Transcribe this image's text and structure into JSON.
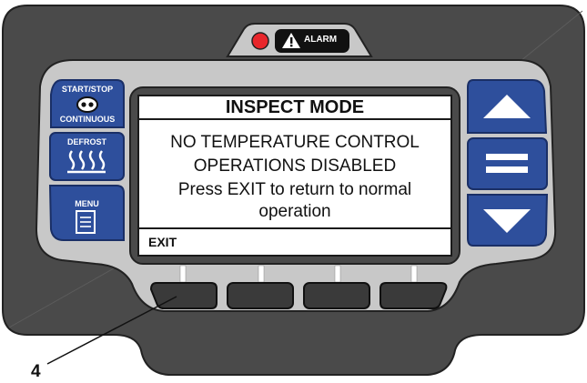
{
  "alarm": {
    "label": "ALARM"
  },
  "left_buttons": {
    "start_stop": {
      "label_top": "START/STOP",
      "label_bottom": "CONTINUOUS"
    },
    "defrost": {
      "label": "DEFROST"
    },
    "menu": {
      "label": "MENU"
    }
  },
  "screen": {
    "title": "INSPECT MODE",
    "lines": [
      "NO TEMPERATURE CONTROL",
      "OPERATIONS DISABLED",
      "Press EXIT to return to normal",
      "operation"
    ],
    "softkey_label": "EXIT"
  },
  "callout": {
    "number": "4"
  },
  "colors": {
    "housing": "#4a4a4a",
    "bezel": "#c8c8c8",
    "button_blue": "#2e4f9c",
    "led_red": "#e8262b",
    "softkey": "#3a3a3a"
  },
  "icons": {
    "start_stop": "start-stop-icon",
    "defrost": "defrost-icon",
    "menu": "menu-icon",
    "up": "arrow-up-icon",
    "select": "equals-icon",
    "down": "arrow-down-icon",
    "alarm": "warning-triangle-icon"
  }
}
